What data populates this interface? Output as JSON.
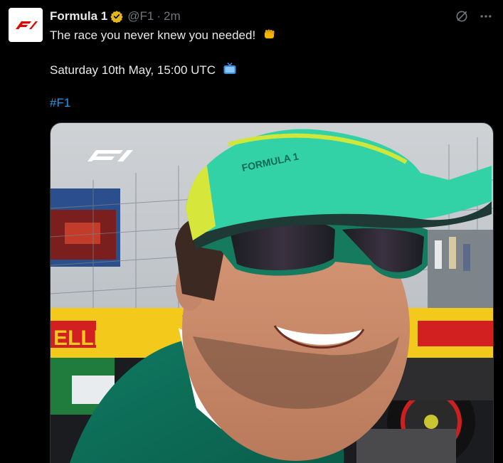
{
  "post": {
    "author": {
      "display_name": "Formula 1",
      "handle": "@F1",
      "separator": "·",
      "time": "2m",
      "verified": true,
      "verified_color": "#e2b719",
      "avatar_icon": "f1-logo-icon",
      "avatar_color": "#e10600"
    },
    "text": {
      "line1": "The race you never knew you needed!",
      "line1_emoji": "fist-emoji",
      "line2": "Saturday 10th May, 15:00 UTC",
      "line2_emoji": "tv-emoji",
      "hashtag": "#F1"
    },
    "media": {
      "type": "video-frame",
      "watermark_icon": "f1-logo-icon",
      "description_icons": [
        "cap",
        "sunglasses",
        "green-shirt",
        "pirelli-banner"
      ],
      "banner_text": "ELLI",
      "cap_text": "FORMULA 1"
    },
    "actions": {
      "grok_icon": "grok-icon",
      "more_icon": "more-icon"
    },
    "colors": {
      "background": "#000000",
      "text": "#e7e9ea",
      "muted": "#71767b",
      "link": "#1d9bf0"
    }
  }
}
